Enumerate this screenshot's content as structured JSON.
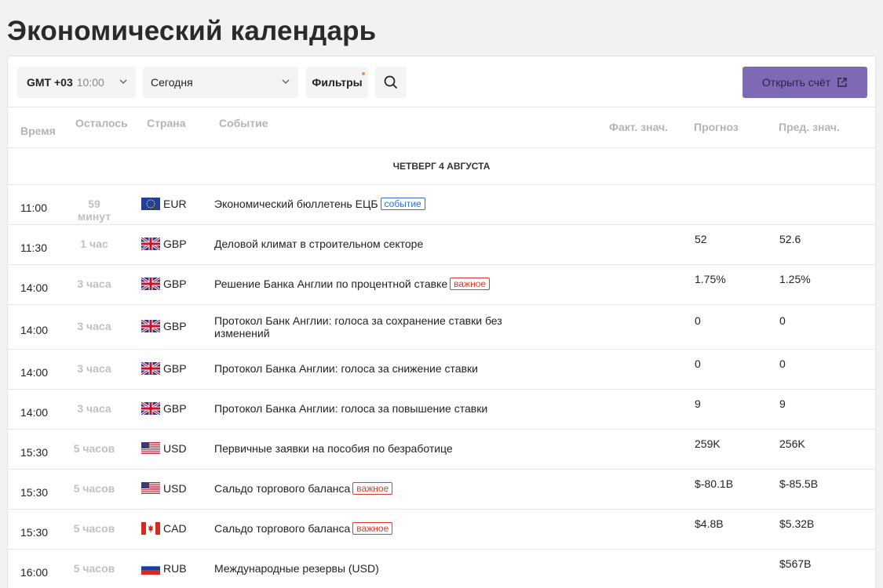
{
  "title": "Экономический календарь",
  "toolbar": {
    "timezone_label": "GMT +03",
    "timezone_time": "10:00",
    "day_select": "Сегодня",
    "filters_label": "Фильтры",
    "open_account_label": "Открыть счёт"
  },
  "columns": {
    "time": "Время",
    "remaining": "Осталось",
    "country": "Страна",
    "event": "Событие",
    "actual": "Факт. знач.",
    "forecast": "Прогноз",
    "previous": "Пред. знач."
  },
  "day_header": "ЧЕТВЕРГ 4 АВГУСТА",
  "colors": {
    "accent": "#7e69b5",
    "important": "#e0392b",
    "event_tag": "#2e6fd1"
  },
  "events": [
    {
      "time": "11:00",
      "remaining": "59 минут",
      "currency": "EUR",
      "flag": "eu-flag-icon",
      "event": "Экономический бюллетень ЕЦБ",
      "tag": "событие",
      "tag_type": "event",
      "actual": "",
      "forecast": "",
      "previous": ""
    },
    {
      "time": "11:30",
      "remaining": "1 час",
      "currency": "GBP",
      "flag": "uk-flag-icon",
      "event": "Деловой климат в строительном секторе",
      "tag": "",
      "tag_type": "",
      "actual": "",
      "forecast": "52",
      "previous": "52.6"
    },
    {
      "time": "14:00",
      "remaining": "3 часа",
      "currency": "GBP",
      "flag": "uk-flag-icon",
      "event": "Решение Банка Англии по процентной ставке",
      "tag": "важное",
      "tag_type": "important",
      "actual": "",
      "forecast": "1.75%",
      "previous": "1.25%"
    },
    {
      "time": "14:00",
      "remaining": "3 часа",
      "currency": "GBP",
      "flag": "uk-flag-icon",
      "event": "Протокол Банк Англии: голоса за сохранение ставки без изменений",
      "tag": "",
      "tag_type": "",
      "actual": "",
      "forecast": "0",
      "previous": "0"
    },
    {
      "time": "14:00",
      "remaining": "3 часа",
      "currency": "GBP",
      "flag": "uk-flag-icon",
      "event": "Протокол Банка Англии: голоса за снижение ставки",
      "tag": "",
      "tag_type": "",
      "actual": "",
      "forecast": "0",
      "previous": "0"
    },
    {
      "time": "14:00",
      "remaining": "3 часа",
      "currency": "GBP",
      "flag": "uk-flag-icon",
      "event": "Протокол Банка Англии: голоса за повышение ставки",
      "tag": "",
      "tag_type": "",
      "actual": "",
      "forecast": "9",
      "previous": "9"
    },
    {
      "time": "15:30",
      "remaining": "5 часов",
      "currency": "USD",
      "flag": "us-flag-icon",
      "event": "Первичные заявки на пособия по безработице",
      "tag": "",
      "tag_type": "",
      "actual": "",
      "forecast": "259K",
      "previous": "256K"
    },
    {
      "time": "15:30",
      "remaining": "5 часов",
      "currency": "USD",
      "flag": "us-flag-icon",
      "event": "Сальдо торгового баланса",
      "tag": "важное",
      "tag_type": "important",
      "actual": "",
      "forecast": "$-80.1B",
      "previous": "$-85.5B"
    },
    {
      "time": "15:30",
      "remaining": "5 часов",
      "currency": "CAD",
      "flag": "ca-flag-icon",
      "event": "Сальдо торгового баланса",
      "tag": "важное",
      "tag_type": "important",
      "actual": "",
      "forecast": "$4.8B",
      "previous": "$5.32B"
    },
    {
      "time": "16:00",
      "remaining": "5 часов",
      "currency": "RUB",
      "flag": "ru-flag-icon",
      "event": "Международные резервы (USD)",
      "tag": "",
      "tag_type": "",
      "actual": "",
      "forecast": "",
      "previous": "$567B"
    }
  ]
}
